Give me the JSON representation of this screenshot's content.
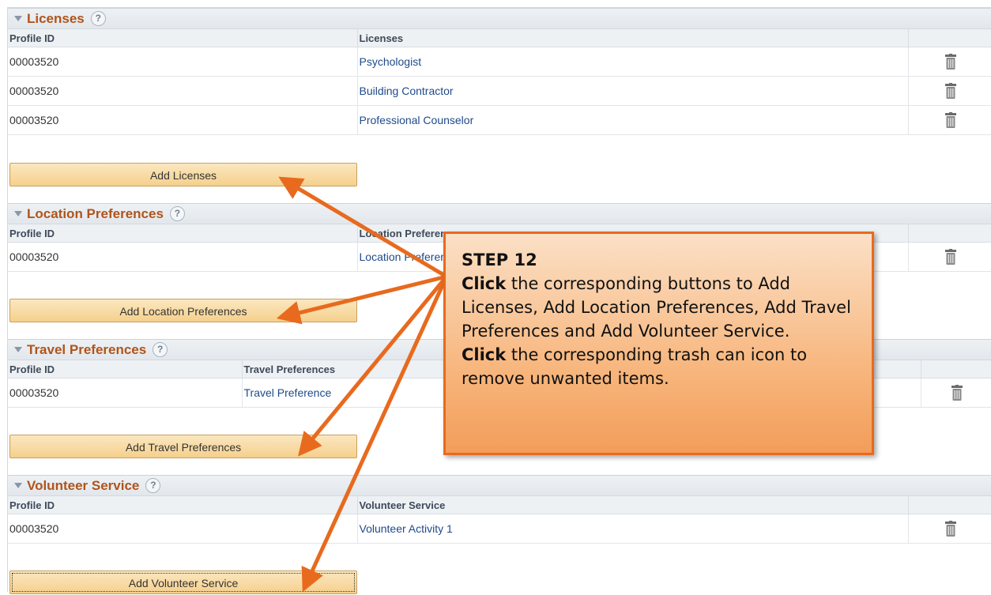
{
  "sections": [
    {
      "title": "Licenses",
      "col1_header": "Profile ID",
      "col2_header": "Licenses",
      "rows": [
        {
          "profile_id": "00003520",
          "value": "Psychologist"
        },
        {
          "profile_id": "00003520",
          "value": "Building Contractor"
        },
        {
          "profile_id": "00003520",
          "value": "Professional Counselor"
        }
      ],
      "button_label": "Add Licenses"
    },
    {
      "title": "Location Preferences",
      "col1_header": "Profile ID",
      "col2_header": "Location Preferences",
      "rows": [
        {
          "profile_id": "00003520",
          "value": "Location Preference"
        }
      ],
      "button_label": "Add Location Preferences"
    },
    {
      "title": "Travel Preferences",
      "col1_header": "Profile ID",
      "col2_header": "Travel Preferences",
      "rows": [
        {
          "profile_id": "00003520",
          "value": "Travel Preference"
        }
      ],
      "button_label": "Add Travel Preferences"
    },
    {
      "title": "Volunteer Service",
      "col1_header": "Profile ID",
      "col2_header": "Volunteer Service",
      "rows": [
        {
          "profile_id": "00003520",
          "value": "Volunteer Activity 1"
        }
      ],
      "button_label": "Add Volunteer Service"
    }
  ],
  "callout": {
    "step": "STEP 12",
    "click1": "Click",
    "text1": " the corresponding buttons to Add Licenses, Add Location Preferences, Add Travel Preferences and Add Volunteer Service.",
    "click2": "Click",
    "text2": " the corresponding trash can icon to remove unwanted items."
  },
  "colors": {
    "section_title": "#b0541b",
    "link": "#1f4a8a",
    "arrow": "#e86a1e",
    "callout_border": "#e86a1e"
  },
  "icons": {
    "help": "question-mark-circle",
    "delete": "trash-can-icon",
    "collapse": "triangle-down"
  }
}
